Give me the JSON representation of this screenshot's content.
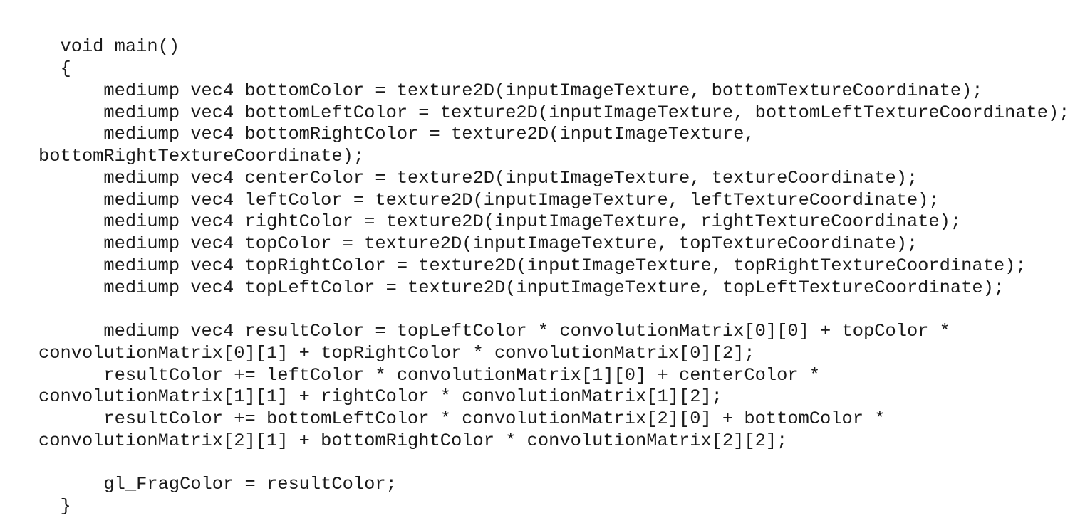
{
  "code": {
    "language": "glsl",
    "lines": [
      "  void main()",
      "  {",
      "      mediump vec4 bottomColor = texture2D(inputImageTexture, bottomTextureCoordinate);",
      "      mediump vec4 bottomLeftColor = texture2D(inputImageTexture, bottomLeftTextureCoordinate);",
      "      mediump vec4 bottomRightColor = texture2D(inputImageTexture,",
      "bottomRightTextureCoordinate);",
      "      mediump vec4 centerColor = texture2D(inputImageTexture, textureCoordinate);",
      "      mediump vec4 leftColor = texture2D(inputImageTexture, leftTextureCoordinate);",
      "      mediump vec4 rightColor = texture2D(inputImageTexture, rightTextureCoordinate);",
      "      mediump vec4 topColor = texture2D(inputImageTexture, topTextureCoordinate);",
      "      mediump vec4 topRightColor = texture2D(inputImageTexture, topRightTextureCoordinate);",
      "      mediump vec4 topLeftColor = texture2D(inputImageTexture, topLeftTextureCoordinate);",
      "",
      "      mediump vec4 resultColor = topLeftColor * convolutionMatrix[0][0] + topColor *",
      "convolutionMatrix[0][1] + topRightColor * convolutionMatrix[0][2];",
      "      resultColor += leftColor * convolutionMatrix[1][0] + centerColor *",
      "convolutionMatrix[1][1] + rightColor * convolutionMatrix[1][2];",
      "      resultColor += bottomLeftColor * convolutionMatrix[2][0] + bottomColor *",
      "convolutionMatrix[2][1] + bottomRightColor * convolutionMatrix[2][2];",
      "",
      "      gl_FragColor = resultColor;",
      "  }"
    ]
  }
}
